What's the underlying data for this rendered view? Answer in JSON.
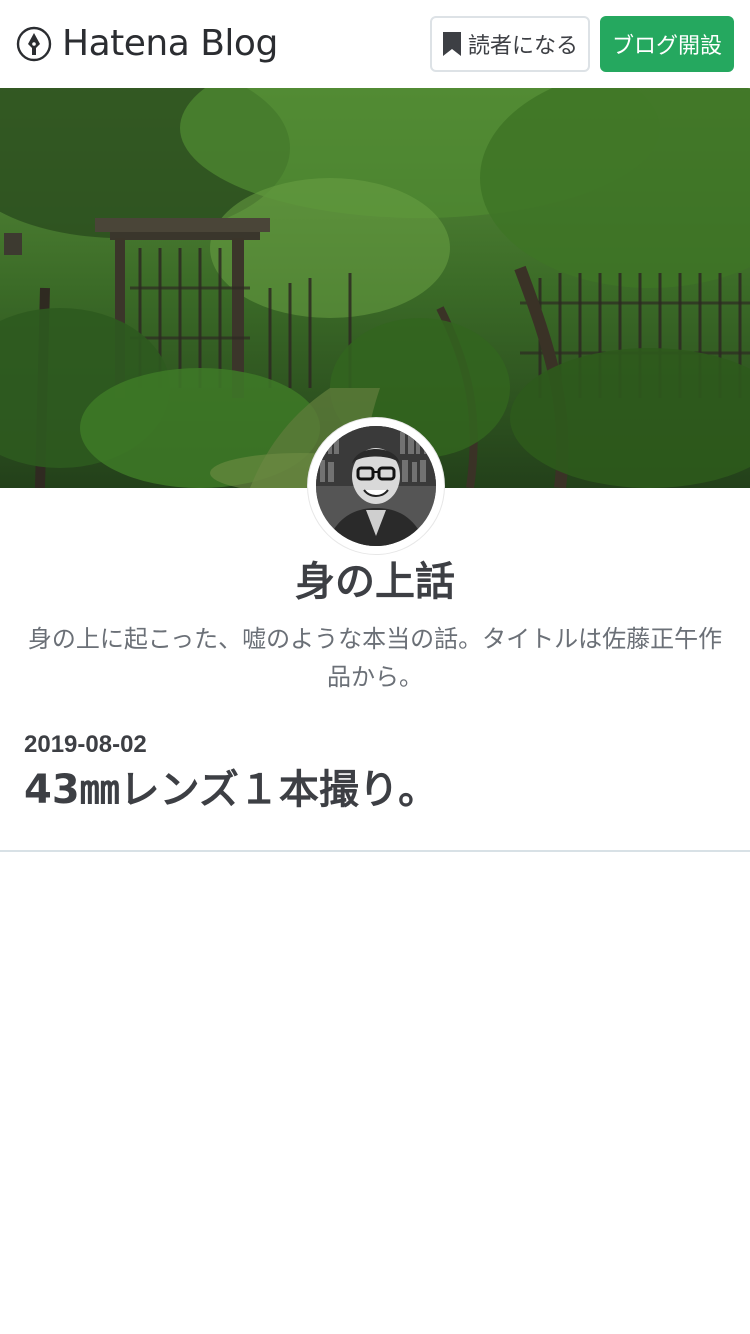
{
  "header": {
    "logo_text": "Hatena Blog",
    "subscribe_label": "読者になる",
    "open_blog_label": "ブログ開設",
    "accent_color": "#25a85f"
  },
  "blog": {
    "title": "身の上話",
    "description": "身の上に起こった、嘘のような本当の話。タイトルは佐藤正午作品から。"
  },
  "entry": {
    "date": "2019-08-02",
    "title": "43㎜レンズ１本撮り。"
  },
  "icons": {
    "logo": "pen-nib-icon",
    "subscribe": "bookmark-icon"
  }
}
